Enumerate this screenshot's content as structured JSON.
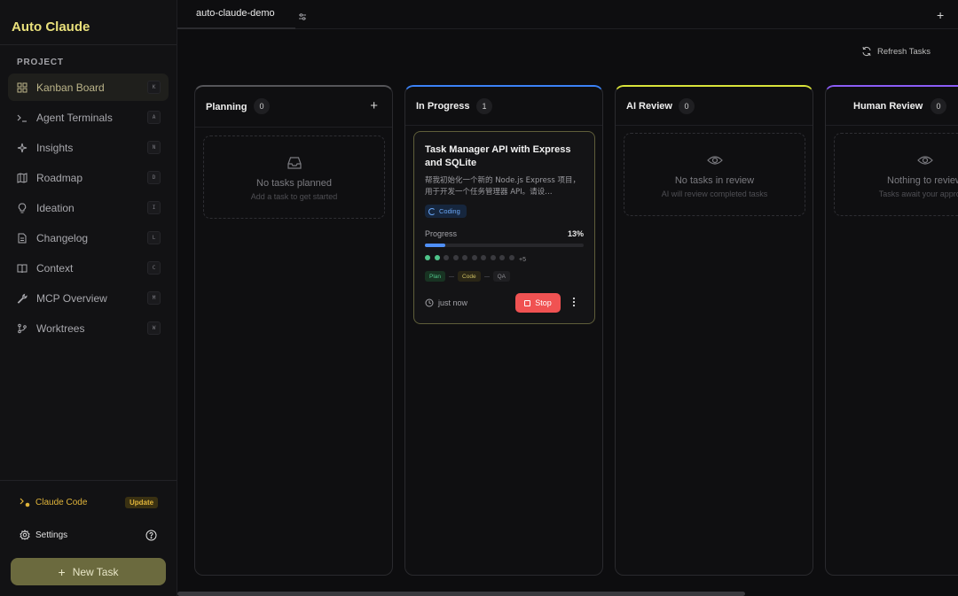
{
  "app": {
    "title": "Auto Claude"
  },
  "sidebar": {
    "section_label": "PROJECT",
    "items": [
      {
        "label": "Kanban Board",
        "icon": "grid-icon",
        "shortcut": "K",
        "active": true
      },
      {
        "label": "Agent Terminals",
        "icon": "terminal-icon",
        "shortcut": "A"
      },
      {
        "label": "Insights",
        "icon": "sparkles-icon",
        "shortcut": "N"
      },
      {
        "label": "Roadmap",
        "icon": "map-icon",
        "shortcut": "D"
      },
      {
        "label": "Ideation",
        "icon": "lightbulb-icon",
        "shortcut": "I"
      },
      {
        "label": "Changelog",
        "icon": "file-text-icon",
        "shortcut": "L"
      },
      {
        "label": "Context",
        "icon": "book-icon",
        "shortcut": "C"
      },
      {
        "label": "MCP Overview",
        "icon": "wrench-icon",
        "shortcut": "M"
      },
      {
        "label": "Worktrees",
        "icon": "git-branch-icon",
        "shortcut": "W"
      }
    ],
    "claude_code_label": "Claude Code",
    "update_badge": "Update",
    "settings_label": "Settings",
    "new_task_label": "New Task"
  },
  "topbar": {
    "project_tab": "auto-claude-demo",
    "refresh_label": "Refresh Tasks"
  },
  "columns": [
    {
      "title": "Planning",
      "count": "0",
      "empty_title": "No tasks planned",
      "empty_sub": "Add a task to get started"
    },
    {
      "title": "In Progress",
      "count": "1"
    },
    {
      "title": "AI Review",
      "count": "0",
      "empty_title": "No tasks in review",
      "empty_sub": "AI will review completed tasks"
    },
    {
      "title": "Human Review",
      "count": "0",
      "empty_title": "Nothing to review",
      "empty_sub": "Tasks await your approval"
    }
  ],
  "task": {
    "title": "Task Manager API with Express and SQLite",
    "description": "帮我初始化一个新的 Node.js Express 项目，用于开发一个任务管理器 API。请设…",
    "status": "Coding",
    "progress_label": "Progress",
    "progress_value": "13%",
    "progress_fraction": 0.13,
    "subtasks_done": 2,
    "subtasks_shown": 10,
    "subtasks_more": "+5",
    "phases": [
      "Plan",
      "Code",
      "QA"
    ],
    "time": "just now",
    "stop_label": "Stop"
  },
  "colors": {
    "accent": "#e9e07b",
    "planning": "#555559",
    "in_progress": "#3b82f6",
    "ai_review": "#d9e33a",
    "human_review": "#8b5cf6",
    "stop": "#f05252"
  }
}
